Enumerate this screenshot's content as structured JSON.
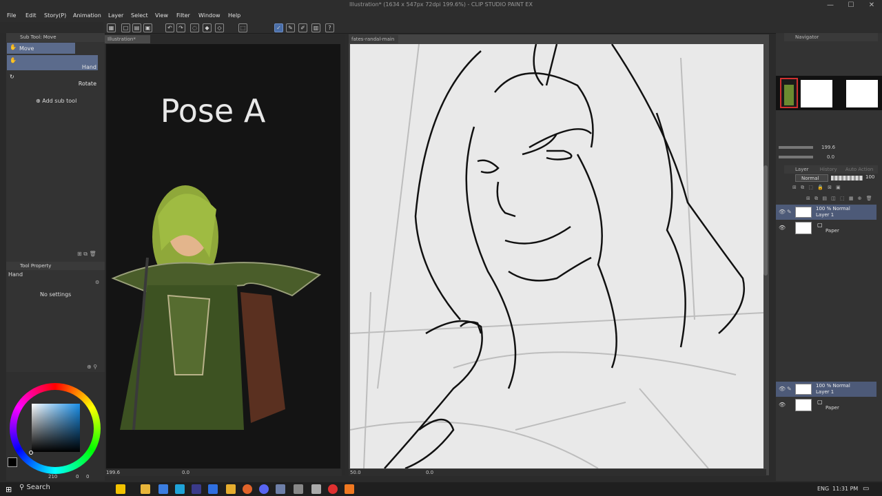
{
  "window": {
    "title": "Illustration* (1634 x 547px 72dpi 199.6%) - CLIP STUDIO PAINT EX",
    "min": "—",
    "max": "☐",
    "close": "✕"
  },
  "menu": [
    "File",
    "Edit",
    "Story(P)",
    "Animation",
    "Layer",
    "Select",
    "View",
    "Filter",
    "Window",
    "Help"
  ],
  "subtool": {
    "header": "Sub Tool: Move",
    "items": [
      {
        "label": "Move",
        "icon": "move-hand-icon"
      },
      {
        "label": "Hand",
        "icon": "hand-icon"
      },
      {
        "label": "Rotate",
        "icon": "rotate-icon"
      }
    ],
    "add_label": "Add sub tool"
  },
  "tool_property": {
    "header": "Tool Property",
    "tool_name": "Hand",
    "empty_text": "No settings"
  },
  "color": {
    "brush_size": "210",
    "value_a": "0",
    "value_b": "0"
  },
  "tabs": {
    "canvas1": "Illustration*",
    "canvas2": "fates-randal-main"
  },
  "canvas1": {
    "overlay_text": "Pose A",
    "zoom": "199.6",
    "angle": "0.0"
  },
  "canvas2": {
    "zoom": "50.0",
    "angle": "0.0"
  },
  "navigator": {
    "header": "Navigator",
    "zoom": "199.6",
    "angle": "0.0"
  },
  "layer_panel": {
    "header": "Layer",
    "tabs": [
      "History",
      "Auto Action"
    ],
    "blend_mode": "Normal",
    "opacity": "100",
    "layers": [
      {
        "line1": "100 % Normal",
        "line2": "Layer 1"
      },
      {
        "line1": "",
        "line2": "Paper"
      }
    ],
    "layers_lower": [
      {
        "line1": "100 % Normal",
        "line2": "Layer 1"
      },
      {
        "line1": "",
        "line2": "Paper"
      }
    ]
  },
  "taskbar": {
    "search": "Search",
    "lang": "ENG",
    "time": "11:31 PM"
  },
  "colors": {
    "accent": "#5b6b8c",
    "layer_selected": "#4d5a78"
  }
}
